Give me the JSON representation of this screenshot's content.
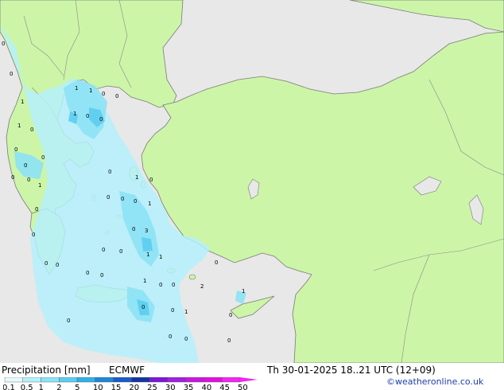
{
  "title": "Precipitation [mm]",
  "model": "ECMWF",
  "valid_time": "Th 30-01-2025 18..21 UTC (12+09)",
  "credit": "©weatheronline.co.uk",
  "legend": {
    "ticks": [
      "0.1",
      "0.5",
      "1",
      "2",
      "5",
      "10",
      "15",
      "20",
      "25",
      "30",
      "35",
      "40",
      "45",
      "50"
    ],
    "colors": [
      "#e6fafe",
      "#b4f0fb",
      "#8ce2f5",
      "#5ccdef",
      "#30b0e8",
      "#2187d8",
      "#1a5cc8",
      "#1434a0",
      "#7c18d8",
      "#a020e0",
      "#c818e0",
      "#e010e0",
      "#f028f0"
    ]
  },
  "colors": {
    "land": "#ccf5a8",
    "sea": "#e8e8e8",
    "border": "#8a8a8a",
    "coast": "#7a7a7a"
  },
  "markers": [
    "0",
    "0",
    "1",
    "1",
    "0",
    "1",
    "1",
    "0",
    "0",
    "1",
    "0",
    "0",
    "0",
    "0",
    "0",
    "0",
    "0",
    "1",
    "0",
    "1",
    "0",
    "0",
    "0",
    "0",
    "0",
    "1",
    "0",
    "0",
    "3",
    "1",
    "1",
    "0",
    "0",
    "0",
    "0",
    "0",
    "1",
    "0",
    "0",
    "2",
    "1",
    "0",
    "0",
    "1",
    "0",
    "0",
    "0",
    "0",
    "0",
    "0",
    "0"
  ]
}
